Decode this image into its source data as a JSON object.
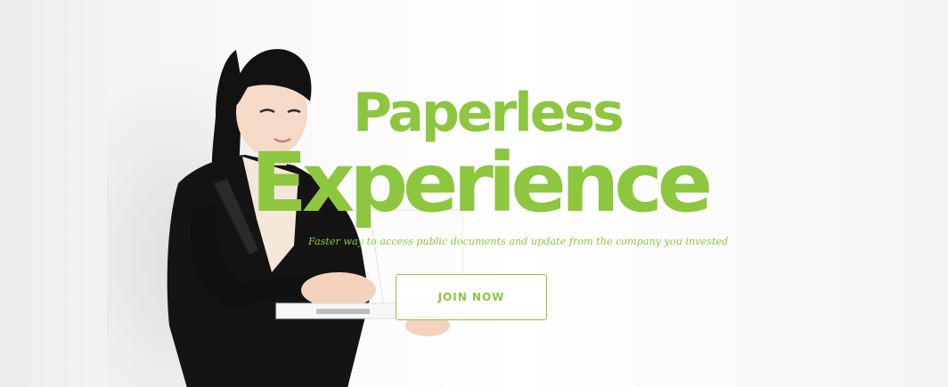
{
  "hero": {
    "title_line1": "Paperless",
    "title_line2": "Experience",
    "tagline": "Faster way to access public documents and update from the company you invested",
    "cta_label": "JOIN NOW"
  },
  "colors": {
    "accent": "#8dc63f",
    "background": "#ffffff",
    "suit": "#141414"
  }
}
